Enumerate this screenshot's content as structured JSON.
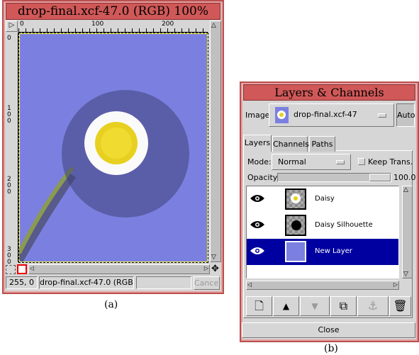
{
  "image_window": {
    "title": "drop-final.xcf-47.0 (RGB) 100%",
    "ruler_top": [
      "0",
      "100",
      "200"
    ],
    "ruler_left": [
      "0",
      "100",
      "200",
      "300"
    ],
    "coords": "255, 0",
    "status": "drop-final.xcf-47.0 (RGB)",
    "cancel_label": "Cancel",
    "canvas_color": "#7b80e0",
    "caption": "(a)"
  },
  "layers_dialog": {
    "title": "Layers & Channels",
    "image_label": "Image:",
    "image_value": "drop-final.xcf-47",
    "auto_label": "Auto",
    "tabs": [
      {
        "label": "Layers",
        "active": true
      },
      {
        "label": "Channels"
      },
      {
        "label": "Paths"
      }
    ],
    "mode_label": "Mode:",
    "mode_value": "Normal",
    "keep_trans_label": "Keep Trans.",
    "opacity_label": "Opacity:",
    "opacity_value": "100.0",
    "layers": [
      {
        "name": "Daisy",
        "visible": true,
        "selected": false
      },
      {
        "name": "Daisy Silhouette",
        "visible": true,
        "selected": false
      },
      {
        "name": "New Layer",
        "visible": true,
        "selected": true
      }
    ],
    "buttons": [
      "new-layer",
      "raise-layer",
      "lower-layer",
      "duplicate-layer",
      "anchor-layer",
      "delete-layer"
    ],
    "close_label": "Close",
    "selection_color": "#0000a0",
    "caption": "(b)"
  }
}
